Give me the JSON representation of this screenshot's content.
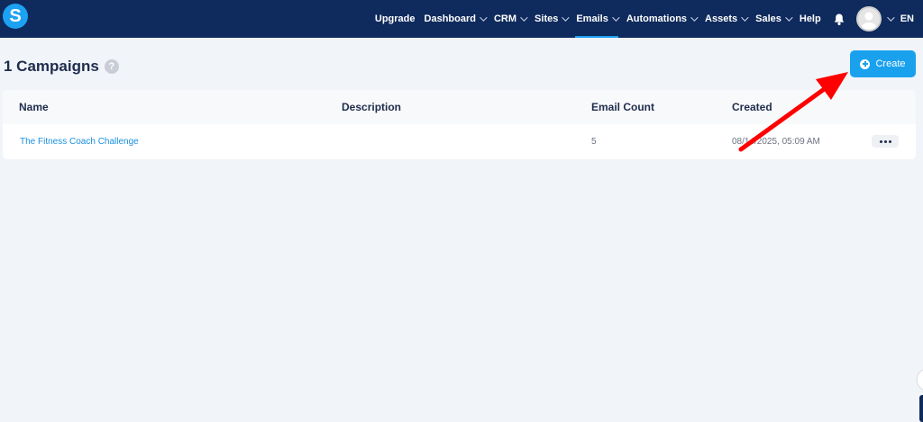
{
  "brand": {
    "logo_letter": "S"
  },
  "nav": {
    "items": [
      {
        "label": "Upgrade",
        "has_dropdown": false
      },
      {
        "label": "Dashboard",
        "has_dropdown": true
      },
      {
        "label": "CRM",
        "has_dropdown": true
      },
      {
        "label": "Sites",
        "has_dropdown": true
      },
      {
        "label": "Emails",
        "has_dropdown": true,
        "active": true
      },
      {
        "label": "Automations",
        "has_dropdown": true
      },
      {
        "label": "Assets",
        "has_dropdown": true
      },
      {
        "label": "Sales",
        "has_dropdown": true
      },
      {
        "label": "Help",
        "has_dropdown": false
      }
    ],
    "bell_icon": "bell-icon",
    "language": "EN"
  },
  "page": {
    "title": "1 Campaigns",
    "help_icon_glyph": "?",
    "create_label": "Create"
  },
  "table": {
    "columns": [
      "Name",
      "Description",
      "Email Count",
      "Created"
    ],
    "rows": [
      {
        "name": "The Fitness Coach Challenge",
        "description": "",
        "email_count": "5",
        "created": "08/14/2025, 05:09 AM"
      }
    ]
  },
  "colors": {
    "topbar": "#0f2a5c",
    "accent": "#1aa1ee",
    "background": "#f1f4f9",
    "annotation_arrow": "#ff0000"
  }
}
